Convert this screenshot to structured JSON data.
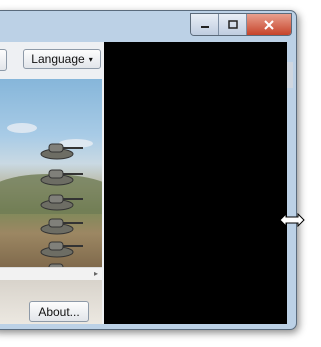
{
  "window": {
    "controls": {
      "minimize": "minimize-icon",
      "maximize": "maximize-icon",
      "close": "close-icon"
    }
  },
  "toolbar": {
    "language_label": "Language",
    "language_caret": "▾"
  },
  "preview": {
    "tanks": [
      "tank-icon",
      "tank-icon",
      "tank-icon",
      "tank-icon",
      "tank-icon",
      "tank-icon"
    ]
  },
  "scrollbar": {
    "arrow": "▸"
  },
  "footer": {
    "about_label": "About..."
  },
  "colors": {
    "client_bg": "#000000",
    "close_button": "#c6442b",
    "frame": "#bcd1e6"
  }
}
